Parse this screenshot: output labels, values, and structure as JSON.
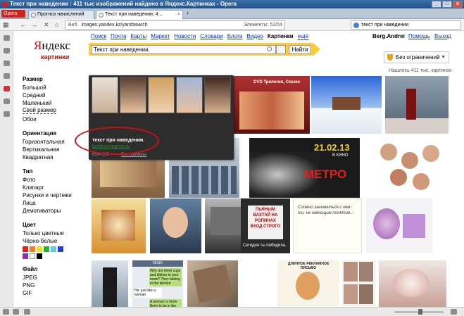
{
  "window": {
    "title": "Текст при наведении : 411 тыс изображений найдено в Яндекс.Картинках - Opera",
    "controls": [
      "_",
      "□",
      "x"
    ]
  },
  "browser": {
    "opera_label": "Opera",
    "tabs": [
      {
        "label": "Прогноз начислений",
        "active": false
      },
      {
        "label": "Текст при наведении: 4...",
        "active": true
      }
    ],
    "address": {
      "prefix": "Веб",
      "url": "images.yandex.kz/yandsearch",
      "elements": "Элементы: 52/54"
    },
    "search": {
      "value": "текст при наведении"
    }
  },
  "yandex": {
    "logo": {
      "first": "Я",
      "rest": "ндекс"
    },
    "logo_sub": "картинки",
    "topnav": [
      "Поиск",
      "Почта",
      "Карты",
      "Маркет",
      "Новости",
      "Словари",
      "Блоги",
      "Видео"
    ],
    "current": "Картинки",
    "more": "ещё",
    "user": "Berg.Andrei",
    "help": "Помощь",
    "logout": "Выход",
    "search_value": "Текст при наведении.",
    "find_button": "Найти",
    "safe_search": "Без ограничений",
    "result_count": "Нашлось 411 тыс. картинок"
  },
  "filters": {
    "size": {
      "title": "Размер",
      "items": [
        "Большой",
        "Средний",
        "Маленький",
        "Свой размер",
        "Обои"
      ]
    },
    "orientation": {
      "title": "Ориентация",
      "items": [
        "Горизонтальная",
        "Вертикальная",
        "Квадратная"
      ]
    },
    "type": {
      "title": "Тип",
      "items": [
        "Фото",
        "Клипарт",
        "Рисунки и чертежи",
        "Лица",
        "Демотиваторы"
      ]
    },
    "color": {
      "title": "Цвет",
      "items": [
        "Только цветные",
        "Чёрно-белые"
      ],
      "swatches": [
        "#e02020",
        "#f08020",
        "#f0e020",
        "#30b030",
        "#60c8e8",
        "#2040d0",
        "#9030b0",
        "#ffffff",
        "#000000"
      ]
    },
    "file": {
      "title": "Файл",
      "items": [
        "JPEG",
        "PNG",
        "GIF"
      ]
    }
  },
  "tooltip": {
    "title": "текст при наведении.",
    "url": "bolshoyvopros.ru",
    "size": "659×165",
    "all_sizes": "Все размеры"
  },
  "thumbnails": {
    "dvd": "DVD Трилогия, Сказки",
    "metro_date": "21.02.13",
    "metro_sub": "В КИНО",
    "metro": "МЕТРО",
    "sign": "ПЬЯНЫМ ВАХТАЙ НА РОПИНАХ ВХОД СТРОГО",
    "sign_caption": "Сегодня ты победила.",
    "sms_header": "Mom",
    "sms_messages": [
      "Why are there cups and dishes in your room? They belong in the kitchen",
      "Ha, just like a woman",
      "A woman is more likely to be in the kitchen than in your bedroom"
    ],
    "cartoon": "ДЛИННОЕ РЕКЛАМНОЕ ПИСЬМО",
    "note": "Сложно заниматься с кем-то, не имеющим понятия..."
  },
  "colors": {
    "accent": "#ffcc33",
    "link": "#0033cc",
    "red_outline": "#d01010",
    "tooltip_bg": "#2d2d2d",
    "url_green": "#2d8c2d"
  }
}
